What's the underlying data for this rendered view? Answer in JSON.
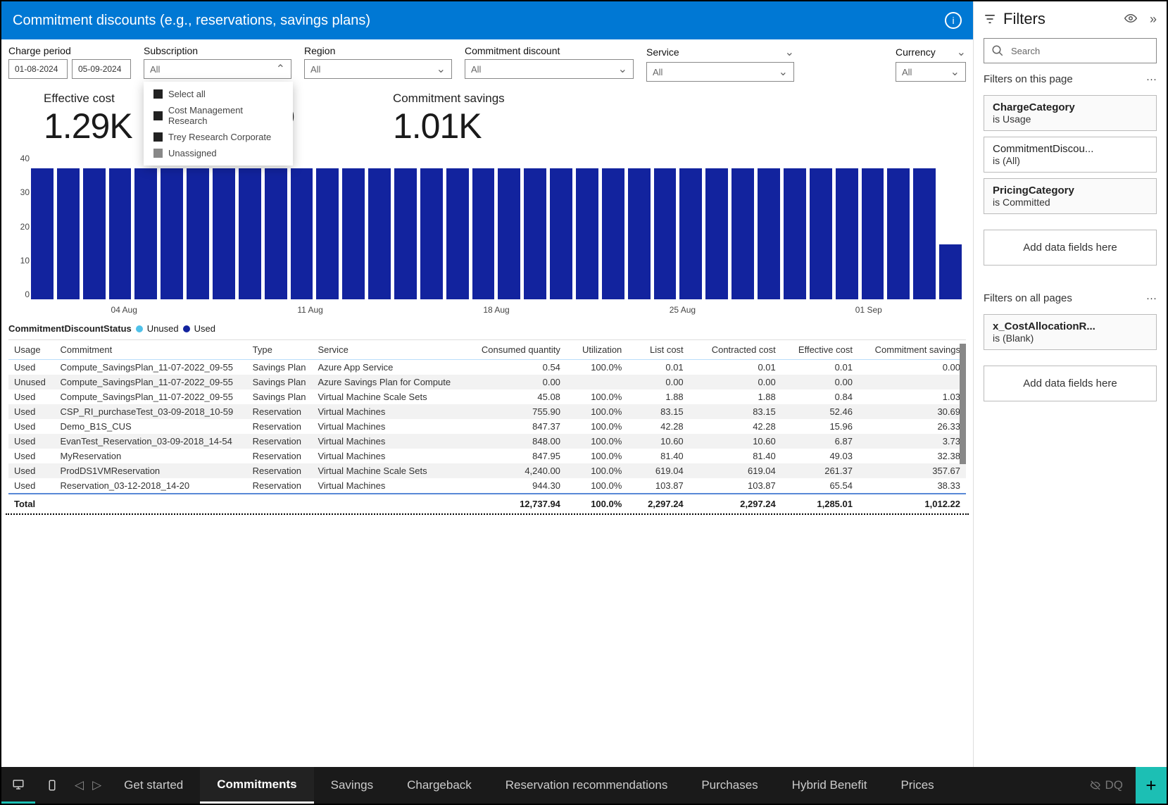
{
  "header": {
    "title": "Commitment discounts (e.g., reservations, savings plans)"
  },
  "slicers": {
    "charge_period": {
      "label": "Charge period",
      "from": "01-08-2024",
      "to": "05-09-2024"
    },
    "subscription": {
      "label": "Subscription",
      "value": "All",
      "options": [
        "Select all",
        "Cost Management Research",
        "Trey Research Corporate",
        "Unassigned"
      ]
    },
    "region": {
      "label": "Region",
      "value": "All"
    },
    "commitment_discount": {
      "label": "Commitment discount",
      "value": "All"
    },
    "service": {
      "label": "Service",
      "value": "All"
    },
    "currency": {
      "label": "Currency",
      "value": "All"
    }
  },
  "kpis": {
    "effective_cost": {
      "label": "Effective cost",
      "value": "1.29K"
    },
    "utilization": {
      "label": "",
      "value": "0%"
    },
    "commitment_savings": {
      "label": "Commitment savings",
      "value": "1.01K"
    }
  },
  "chart_data": {
    "type": "bar",
    "ylim": [
      0,
      40
    ],
    "y_ticks": [
      0,
      10,
      20,
      30,
      40
    ],
    "x_ticks": [
      "04 Aug",
      "11 Aug",
      "18 Aug",
      "25 Aug",
      "01 Sep"
    ],
    "categories": [
      "01 Aug",
      "02 Aug",
      "03 Aug",
      "04 Aug",
      "05 Aug",
      "06 Aug",
      "07 Aug",
      "08 Aug",
      "09 Aug",
      "10 Aug",
      "11 Aug",
      "12 Aug",
      "13 Aug",
      "14 Aug",
      "15 Aug",
      "16 Aug",
      "17 Aug",
      "18 Aug",
      "19 Aug",
      "20 Aug",
      "21 Aug",
      "22 Aug",
      "23 Aug",
      "24 Aug",
      "25 Aug",
      "26 Aug",
      "27 Aug",
      "28 Aug",
      "29 Aug",
      "30 Aug",
      "31 Aug",
      "01 Sep",
      "02 Sep",
      "03 Sep",
      "04 Sep",
      "05 Sep"
    ],
    "series": [
      {
        "name": "Used",
        "color": "#12239e",
        "values": [
          36,
          36,
          36,
          36,
          36,
          36,
          36,
          36,
          36,
          36,
          36,
          36,
          36,
          36,
          36,
          36,
          36,
          36,
          36,
          36,
          36,
          36,
          36,
          36,
          36,
          36,
          36,
          36,
          36,
          36,
          36,
          36,
          36,
          36,
          36,
          15
        ]
      }
    ],
    "legend_title": "CommitmentDiscountStatus",
    "legend": [
      "Unused",
      "Used"
    ]
  },
  "table": {
    "columns": [
      "Usage",
      "Commitment",
      "Type",
      "Service",
      "Consumed quantity",
      "Utilization",
      "List cost",
      "Contracted cost",
      "Effective cost",
      "Commitment savings"
    ],
    "rows": [
      [
        "Used",
        "Compute_SavingsPlan_11-07-2022_09-55",
        "Savings Plan",
        "Azure App Service",
        "0.54",
        "100.0%",
        "0.01",
        "0.01",
        "0.01",
        "0.00"
      ],
      [
        "Unused",
        "Compute_SavingsPlan_11-07-2022_09-55",
        "Savings Plan",
        "Azure Savings Plan for Compute",
        "0.00",
        "",
        "0.00",
        "0.00",
        "0.00",
        ""
      ],
      [
        "Used",
        "Compute_SavingsPlan_11-07-2022_09-55",
        "Savings Plan",
        "Virtual Machine Scale Sets",
        "45.08",
        "100.0%",
        "1.88",
        "1.88",
        "0.84",
        "1.03"
      ],
      [
        "Used",
        "CSP_RI_purchaseTest_03-09-2018_10-59",
        "Reservation",
        "Virtual Machines",
        "755.90",
        "100.0%",
        "83.15",
        "83.15",
        "52.46",
        "30.69"
      ],
      [
        "Used",
        "Demo_B1S_CUS",
        "Reservation",
        "Virtual Machines",
        "847.37",
        "100.0%",
        "42.28",
        "42.28",
        "15.96",
        "26.33"
      ],
      [
        "Used",
        "EvanTest_Reservation_03-09-2018_14-54",
        "Reservation",
        "Virtual Machines",
        "848.00",
        "100.0%",
        "10.60",
        "10.60",
        "6.87",
        "3.73"
      ],
      [
        "Used",
        "MyReservation",
        "Reservation",
        "Virtual Machines",
        "847.95",
        "100.0%",
        "81.40",
        "81.40",
        "49.03",
        "32.38"
      ],
      [
        "Used",
        "ProdDS1VMReservation",
        "Reservation",
        "Virtual Machine Scale Sets",
        "4,240.00",
        "100.0%",
        "619.04",
        "619.04",
        "261.37",
        "357.67"
      ],
      [
        "Used",
        "Reservation_03-12-2018_14-20",
        "Reservation",
        "Virtual Machines",
        "944.30",
        "100.0%",
        "103.87",
        "103.87",
        "65.54",
        "38.33"
      ]
    ],
    "totals": [
      "Total",
      "",
      "",
      "",
      "12,737.94",
      "100.0%",
      "2,297.24",
      "2,297.24",
      "1,285.01",
      "1,012.22"
    ]
  },
  "filters": {
    "title": "Filters",
    "search_placeholder": "Search",
    "page_section": "Filters on this page",
    "all_section": "Filters on all pages",
    "add_label": "Add data fields here",
    "page_filters": [
      {
        "name": "ChargeCategory",
        "value": "is Usage",
        "bold": true
      },
      {
        "name": "CommitmentDiscou...",
        "value": "is (All)",
        "bold": false
      },
      {
        "name": "PricingCategory",
        "value": "is Committed",
        "bold": true
      }
    ],
    "all_filters": [
      {
        "name": "x_CostAllocationR...",
        "value": "is (Blank)",
        "bold": true
      }
    ]
  },
  "tabs": {
    "items": [
      "Get started",
      "Commitments",
      "Savings",
      "Chargeback",
      "Reservation recommendations",
      "Purchases",
      "Hybrid Benefit",
      "Prices"
    ],
    "hidden": "DQ",
    "active": "Commitments"
  }
}
